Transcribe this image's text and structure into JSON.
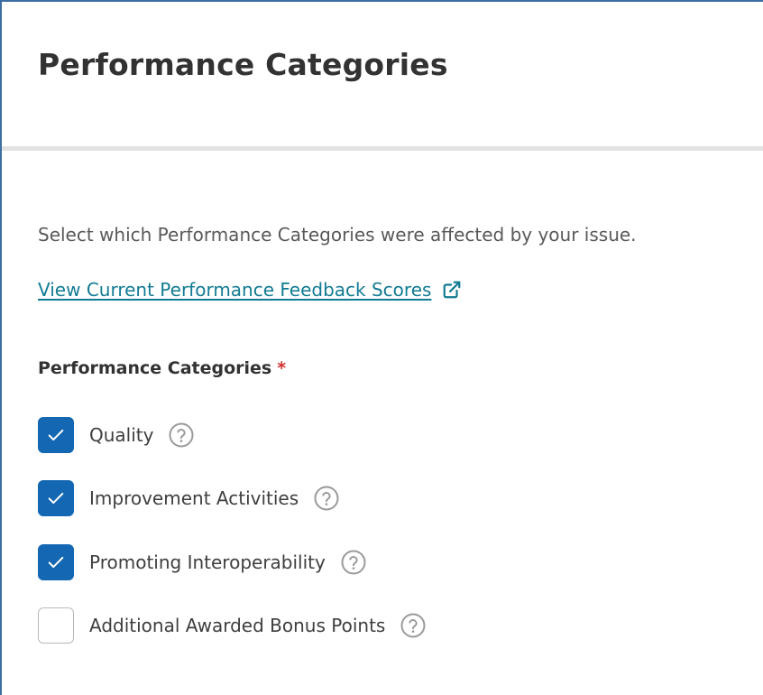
{
  "header": {
    "title": "Performance Categories"
  },
  "main": {
    "instruction": "Select which Performance Categories were affected by your issue.",
    "feedback_link": "View Current Performance Feedback Scores",
    "section_label": "Performance Categories",
    "required_mark": "*",
    "options": [
      {
        "label": "Quality",
        "checked": true
      },
      {
        "label": "Improvement Activities",
        "checked": true
      },
      {
        "label": "Promoting Interoperability",
        "checked": true
      },
      {
        "label": "Additional Awarded Bonus Points",
        "checked": false
      }
    ]
  },
  "icons": {
    "link": "external-link-icon",
    "help": "question-circle-icon",
    "check": "checkmark-icon"
  },
  "colors": {
    "accent": "#1467b3",
    "link": "#127b92",
    "required": "#d32f2f",
    "frame": "#3a6ea5"
  }
}
